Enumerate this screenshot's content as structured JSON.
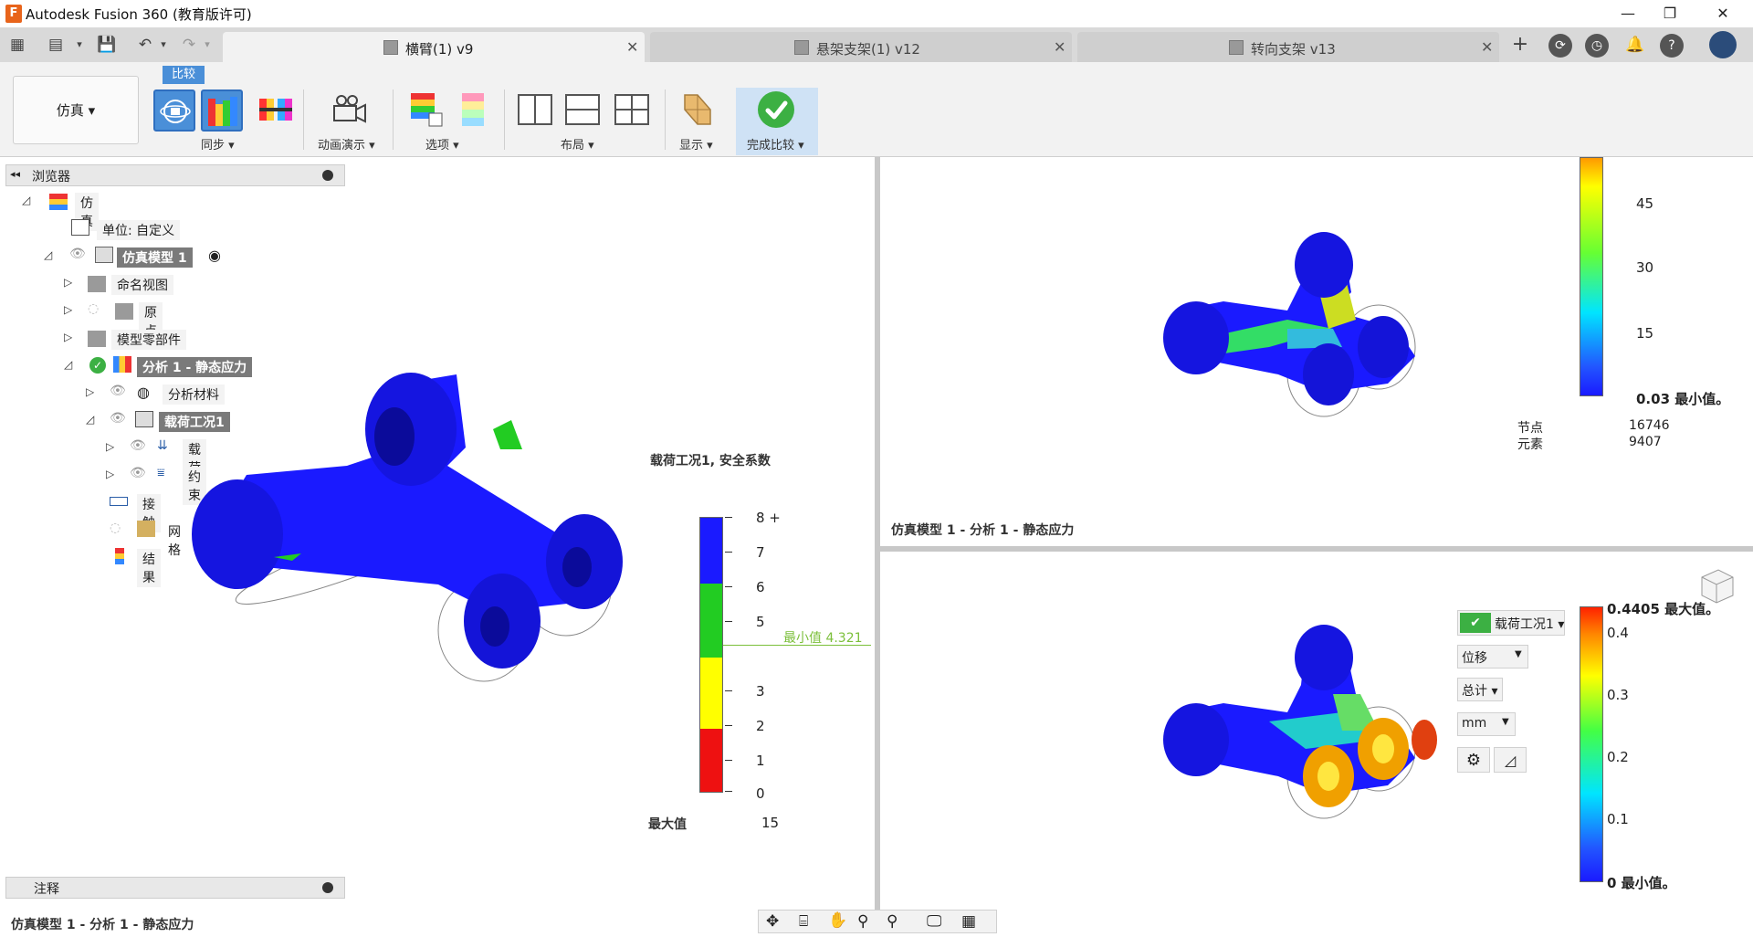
{
  "window": {
    "title": "Autodesk Fusion 360 (教育版许可)",
    "logo_letter": "F",
    "controls": {
      "minimize": "—",
      "restore": "❐",
      "close": "✕"
    }
  },
  "tabs": [
    {
      "label": "横臂(1) v9",
      "active": true
    },
    {
      "label": "悬架支架(1) v12",
      "active": false
    },
    {
      "label": "转向支架 v13",
      "active": false
    }
  ],
  "toolbar": {
    "workspace": "仿真 ▾",
    "compare_tag": "比较",
    "groups": {
      "sync": "同步 ▾",
      "animation": "动画演示 ▾",
      "options": "选项 ▾",
      "layout": "布局 ▾",
      "display": "显示 ▾",
      "finish_compare": "完成比较 ▾"
    }
  },
  "browser": {
    "title": "浏览器",
    "items": [
      {
        "label": "仿真"
      },
      {
        "label": "单位: 自定义"
      },
      {
        "label": "仿真模型 1"
      },
      {
        "label": "命名视图"
      },
      {
        "label": "原点"
      },
      {
        "label": "模型零部件"
      },
      {
        "label": "分析 1 - 静态应力"
      },
      {
        "label": "分析材料"
      },
      {
        "label": "载荷工况1"
      },
      {
        "label": "载荷"
      },
      {
        "label": "约束"
      },
      {
        "label": "接触"
      },
      {
        "label": "网格"
      },
      {
        "label": "结果"
      }
    ]
  },
  "notes": {
    "title": "注释"
  },
  "viewport_left": {
    "legend_title": "载荷工况1, 安全系数",
    "ticks": [
      "8 +",
      "7",
      "6",
      "5",
      "3",
      "2",
      "1",
      "0"
    ],
    "min_label": "最小值  4.321",
    "max_label": "最大值",
    "max_value": "15",
    "footer": "仿真模型 1 - 分析 1 - 静态应力"
  },
  "viewport_top_right": {
    "ticks": [
      "45",
      "30",
      "15",
      "0.03 最小值。"
    ],
    "nodes_label": "节点",
    "nodes_value": "16746",
    "elements_label": "元素",
    "elements_value": "9407",
    "footer": "仿真模型 1 - 分析 1 - 静态应力"
  },
  "viewport_bottom_right": {
    "load_case": "载荷工况1 ▾",
    "result_type": "位移",
    "component": "总计 ▾",
    "unit": "mm",
    "ticks": [
      "0.4405 最大值。",
      "0.4",
      "0.3",
      "0.2",
      "0.1",
      "0 最小值。"
    ]
  },
  "status": {
    "footer": "仿真模型 1 - 分析 1 - 静态应力"
  },
  "colors": {
    "accent": "#4a8fd8",
    "check_green": "#3cb043",
    "model_blue": "#1010d8"
  }
}
